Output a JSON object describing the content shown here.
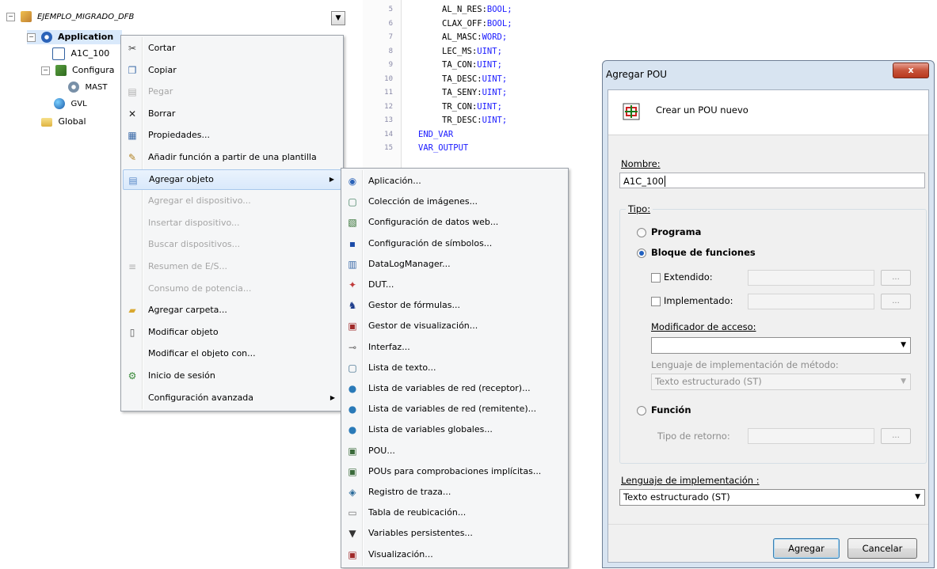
{
  "tree": {
    "project": "EJEMPLO_MIGRADO_DFB",
    "application": "Application",
    "items": [
      "A1C_100",
      "Configura",
      "MAST",
      "GVL"
    ],
    "global": "Global"
  },
  "code": {
    "lines": [
      {
        "num": "5",
        "ident": "AL_N_RES",
        "type": "BOOL"
      },
      {
        "num": "6",
        "ident": "CLAX_OFF",
        "type": "BOOL"
      },
      {
        "num": "7",
        "ident": "AL_MASC",
        "type": "WORD"
      },
      {
        "num": "8",
        "ident": "LEC_MS",
        "type": "UINT"
      },
      {
        "num": "9",
        "ident": "TA_CON",
        "type": "UINT"
      },
      {
        "num": "10",
        "ident": "TA_DESC",
        "type": "UINT"
      },
      {
        "num": "11",
        "ident": "TA_SENY",
        "type": "UINT"
      },
      {
        "num": "12",
        "ident": "TR_CON",
        "type": "UINT"
      },
      {
        "num": "13",
        "ident": "TR_DESC",
        "type": "UINT"
      },
      {
        "num": "14",
        "keyword": "END_VAR"
      },
      {
        "num": "15",
        "keyword": "VAR_OUTPUT"
      }
    ]
  },
  "context_menu": {
    "items": [
      {
        "label": "Cortar",
        "icon": "scissors-icon",
        "disabled": false
      },
      {
        "label": "Copiar",
        "icon": "copy-icon",
        "disabled": false
      },
      {
        "label": "Pegar",
        "icon": "paste-icon",
        "disabled": true
      },
      {
        "label": "Borrar",
        "icon": "delete-x-icon",
        "disabled": false
      },
      {
        "label": "Propiedades...",
        "icon": "properties-icon",
        "disabled": false
      },
      {
        "label": "Añadir función a partir de una plantilla",
        "icon": "template-icon",
        "disabled": false
      },
      {
        "label": "Agregar objeto",
        "icon": "add-object-icon",
        "disabled": false,
        "highlighted": true,
        "submenu": true
      },
      {
        "label": "Agregar el dispositivo...",
        "disabled": true
      },
      {
        "label": "Insertar dispositivo...",
        "disabled": true
      },
      {
        "label": "Buscar dispositivos...",
        "disabled": true
      },
      {
        "label": "Resumen de E/S...",
        "icon": "io-summary-icon",
        "disabled": true
      },
      {
        "label": "Consumo de potencia...",
        "disabled": true
      },
      {
        "label": "Agregar carpeta...",
        "icon": "folder-icon",
        "disabled": false
      },
      {
        "label": "Modificar objeto",
        "icon": "edit-object-icon",
        "disabled": false
      },
      {
        "label": "Modificar el objeto con...",
        "disabled": false
      },
      {
        "label": "Inicio de sesión",
        "icon": "login-icon",
        "disabled": false
      },
      {
        "label": "Configuración avanzada",
        "disabled": false,
        "submenu": true
      }
    ]
  },
  "submenu": {
    "items": [
      {
        "label": "Aplicación...",
        "icon": "application-icon"
      },
      {
        "label": "Colección de imágenes...",
        "icon": "image-collection-icon"
      },
      {
        "label": "Configuración de datos web...",
        "icon": "web-data-icon"
      },
      {
        "label": "Configuración de símbolos...",
        "icon": "symbol-config-icon"
      },
      {
        "label": "DataLogManager...",
        "icon": "datalog-icon"
      },
      {
        "label": "DUT...",
        "icon": "dut-icon"
      },
      {
        "label": "Gestor de fórmulas...",
        "icon": "recipe-manager-icon"
      },
      {
        "label": "Gestor de visualización...",
        "icon": "visualization-manager-icon"
      },
      {
        "label": "Interfaz...",
        "icon": "interface-icon"
      },
      {
        "label": "Lista de texto...",
        "icon": "text-list-icon"
      },
      {
        "label": "Lista de variables de red (receptor)...",
        "icon": "network-receiver-icon"
      },
      {
        "label": "Lista de variables de red (remitente)...",
        "icon": "network-sender-icon"
      },
      {
        "label": "Lista de variables globales...",
        "icon": "globe-icon"
      },
      {
        "label": "POU...",
        "icon": "pou-icon"
      },
      {
        "label": "POUs para comprobaciones implícitas...",
        "icon": "pou-checks-icon"
      },
      {
        "label": "Registro de traza...",
        "icon": "trace-icon"
      },
      {
        "label": "Tabla de reubicación...",
        "icon": "relocation-table-icon"
      },
      {
        "label": "Variables persistentes...",
        "icon": "persistent-vars-icon"
      },
      {
        "label": "Visualización...",
        "icon": "visualization-icon"
      }
    ]
  },
  "dialog": {
    "title": "Agregar POU",
    "close": "x",
    "header_text": "Crear un POU nuevo",
    "name_label": "Nombre:",
    "name_value": "A1C_100",
    "tipo_label": "Tipo:",
    "programa": "Programa",
    "bloque": "Bloque de funciones",
    "extendido": "Extendido:",
    "implementado": "Implementado:",
    "browse": "...",
    "modificador_label": "Modificador de acceso:",
    "lenguaje_metodo_label": "Lenguaje de implementación de método:",
    "lenguaje_metodo_value": "Texto estructurado (ST)",
    "funcion": "Función",
    "tipo_retorno_label": "Tipo de retorno:",
    "lenguaje_label": "Lenguaje de implementación :",
    "lenguaje_value": "Texto estructurado (ST)",
    "agregar": "Agregar",
    "cancelar": "Cancelar"
  },
  "colors": {
    "highlight": "#d9e9fb",
    "dialog_frame": "#d8e4f1",
    "close_button": "#c7533a",
    "keyword": "#1a1aff"
  }
}
